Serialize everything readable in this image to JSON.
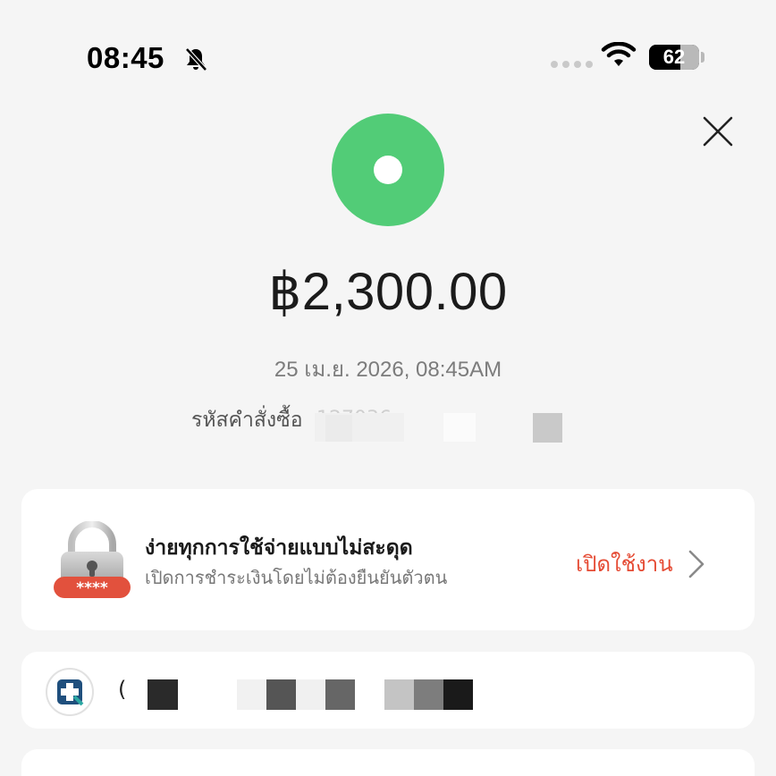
{
  "status_bar": {
    "time": "08:45",
    "battery_percent": "62",
    "battery_level": 0.62
  },
  "receipt": {
    "amount": "฿2,300.00",
    "datetime": "25 เม.ย. 2026, 08:45AM",
    "order_label": "รหัสคำสั่งซื้อ",
    "order_value": "127036"
  },
  "promo": {
    "title": "ง่ายทุกการใช้จ่ายแบบไม่สะดุด",
    "subtitle": "เปิดการชำระเงินโดยไม่ต้องยืนยันตัวตน",
    "action_label": "เปิดใช้งาน",
    "lock_pin": "****"
  },
  "merchant": {
    "name": "("
  },
  "colors": {
    "success": "#52cc77",
    "accent": "#e54b34",
    "background": "#f5f5f5",
    "card": "#ffffff"
  },
  "icons": [
    "bell-slash-icon",
    "wifi-icon",
    "close-icon",
    "success-ring-icon",
    "lock-icon",
    "chevron-right-icon",
    "merchant-logo-icon"
  ]
}
